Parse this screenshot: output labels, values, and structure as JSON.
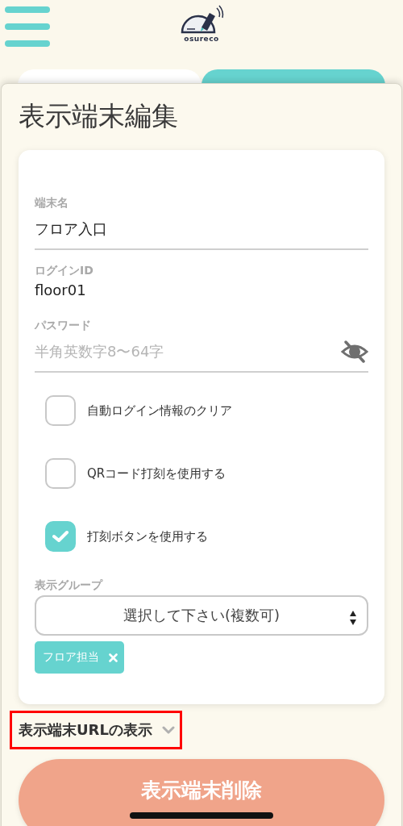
{
  "header": {
    "logo_text": "osureco"
  },
  "dialog": {
    "title": "表示端末編集",
    "fields": [
      {
        "kind": "text",
        "label": "端末名",
        "value": "フロア入口"
      },
      {
        "kind": "static",
        "label": "ログインID",
        "value": "floor01"
      },
      {
        "kind": "password",
        "label": "パスワード",
        "placeholder": "半角英数字8〜64字"
      }
    ],
    "checkboxes": [
      {
        "label": "自動ログイン情報のクリア",
        "checked": false
      },
      {
        "label": "QRコード打刻を使用する",
        "checked": false
      },
      {
        "label": "打刻ボタンを使用する",
        "checked": true
      }
    ],
    "group": {
      "label": "表示グループ",
      "placeholder": "選択して下さい(複数可)",
      "tags": [
        "フロア担当"
      ]
    },
    "url_toggle": {
      "label": "表示端末URLの表示",
      "expanded": false
    },
    "delete_button": "表示端末削除"
  }
}
